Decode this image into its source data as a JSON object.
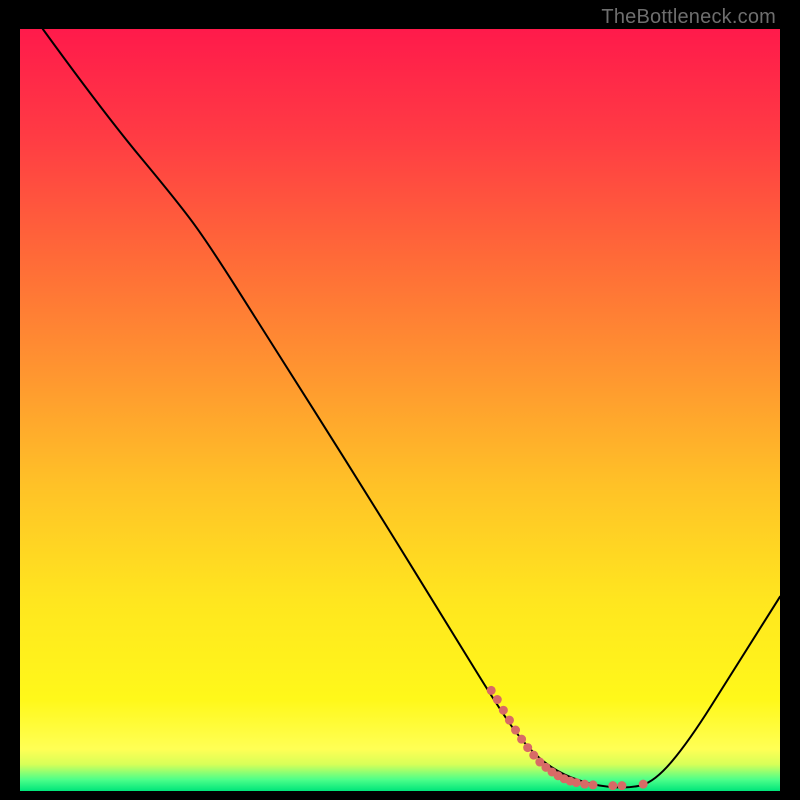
{
  "watermark": "TheBottleneck.com",
  "chart_data": {
    "type": "line",
    "title": "",
    "xlabel": "",
    "ylabel": "",
    "xlim": [
      0,
      100
    ],
    "ylim": [
      0,
      100
    ],
    "gradient_stops": [
      {
        "offset": 0.0,
        "color": "#ff1a4b"
      },
      {
        "offset": 0.14,
        "color": "#ff3b44"
      },
      {
        "offset": 0.3,
        "color": "#ff6a38"
      },
      {
        "offset": 0.45,
        "color": "#ff9530"
      },
      {
        "offset": 0.6,
        "color": "#ffc227"
      },
      {
        "offset": 0.75,
        "color": "#ffe61f"
      },
      {
        "offset": 0.88,
        "color": "#fff81a"
      },
      {
        "offset": 0.945,
        "color": "#ffff55"
      },
      {
        "offset": 0.965,
        "color": "#d8ff58"
      },
      {
        "offset": 0.985,
        "color": "#4dff8a"
      },
      {
        "offset": 1.0,
        "color": "#00e57a"
      }
    ],
    "series": [
      {
        "name": "bottleneck-curve",
        "stroke": "#000000",
        "stroke_width": 2,
        "points": [
          {
            "x": 3.0,
            "y": 100.0
          },
          {
            "x": 11.0,
            "y": 89.0
          },
          {
            "x": 21.0,
            "y": 77.0
          },
          {
            "x": 25.0,
            "y": 71.5
          },
          {
            "x": 32.0,
            "y": 60.5
          },
          {
            "x": 45.0,
            "y": 40.0
          },
          {
            "x": 58.0,
            "y": 19.0
          },
          {
            "x": 62.0,
            "y": 12.5
          },
          {
            "x": 66.0,
            "y": 6.5
          },
          {
            "x": 70.0,
            "y": 2.8
          },
          {
            "x": 75.0,
            "y": 0.8
          },
          {
            "x": 80.0,
            "y": 0.3
          },
          {
            "x": 83.5,
            "y": 1.2
          },
          {
            "x": 88.0,
            "y": 6.5
          },
          {
            "x": 94.0,
            "y": 16.0
          },
          {
            "x": 100.0,
            "y": 25.5
          }
        ]
      },
      {
        "name": "highlight-dots",
        "stroke": "#d86a66",
        "marker": "circle",
        "marker_size": 9,
        "points": [
          {
            "x": 62.0,
            "y": 13.2
          },
          {
            "x": 62.8,
            "y": 12.0
          },
          {
            "x": 63.6,
            "y": 10.6
          },
          {
            "x": 64.4,
            "y": 9.3
          },
          {
            "x": 65.2,
            "y": 8.0
          },
          {
            "x": 66.0,
            "y": 6.8
          },
          {
            "x": 66.8,
            "y": 5.7
          },
          {
            "x": 67.6,
            "y": 4.7
          },
          {
            "x": 68.4,
            "y": 3.8
          },
          {
            "x": 69.2,
            "y": 3.1
          },
          {
            "x": 70.0,
            "y": 2.5
          },
          {
            "x": 70.8,
            "y": 2.0
          },
          {
            "x": 71.6,
            "y": 1.6
          },
          {
            "x": 72.4,
            "y": 1.3
          },
          {
            "x": 73.2,
            "y": 1.1
          },
          {
            "x": 74.3,
            "y": 0.9
          },
          {
            "x": 75.4,
            "y": 0.8
          },
          {
            "x": 78.0,
            "y": 0.7
          },
          {
            "x": 79.2,
            "y": 0.7
          },
          {
            "x": 82.0,
            "y": 0.9
          }
        ]
      }
    ]
  }
}
